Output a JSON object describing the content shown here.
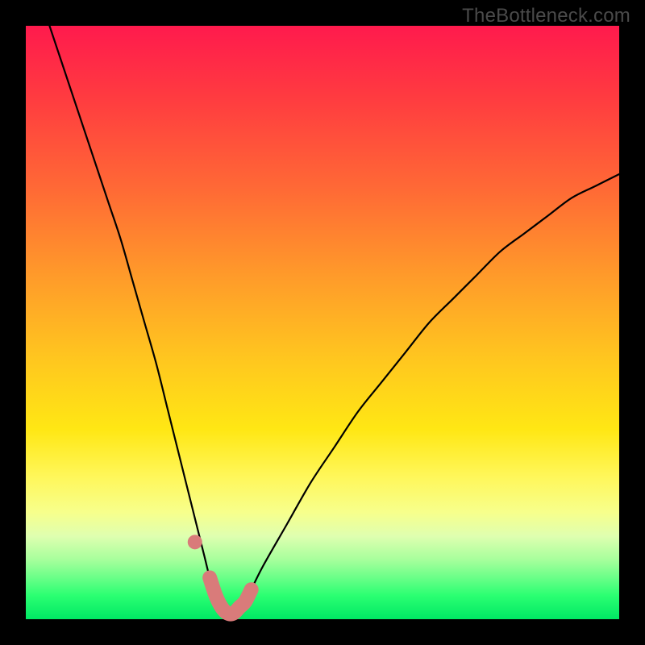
{
  "watermark": "TheBottleneck.com",
  "chart_data": {
    "type": "line",
    "title": "",
    "xlabel": "",
    "ylabel": "",
    "xlim": [
      0,
      100
    ],
    "ylim": [
      0,
      100
    ],
    "series": [
      {
        "name": "bottleneck-curve",
        "x": [
          4,
          6,
          8,
          10,
          12,
          14,
          16,
          18,
          20,
          22,
          24,
          26,
          28,
          30,
          31,
          32,
          33,
          34,
          35,
          36,
          37,
          38,
          40,
          44,
          48,
          52,
          56,
          60,
          64,
          68,
          72,
          76,
          80,
          84,
          88,
          92,
          96,
          100
        ],
        "values": [
          100,
          94,
          88,
          82,
          76,
          70,
          64,
          57,
          50,
          43,
          35,
          27,
          19,
          11,
          7,
          4,
          2,
          1,
          1,
          2,
          3,
          5,
          9,
          16,
          23,
          29,
          35,
          40,
          45,
          50,
          54,
          58,
          62,
          65,
          68,
          71,
          73,
          75
        ]
      }
    ],
    "highlight_segment": {
      "name": "bottom-highlight",
      "color": "#d97b7a",
      "x": [
        28,
        30,
        31,
        32,
        33,
        34,
        35,
        36,
        37,
        38,
        40
      ],
      "values": [
        19,
        11,
        7,
        4,
        2,
        1,
        1,
        2,
        3,
        5,
        9
      ]
    },
    "annotations": []
  }
}
